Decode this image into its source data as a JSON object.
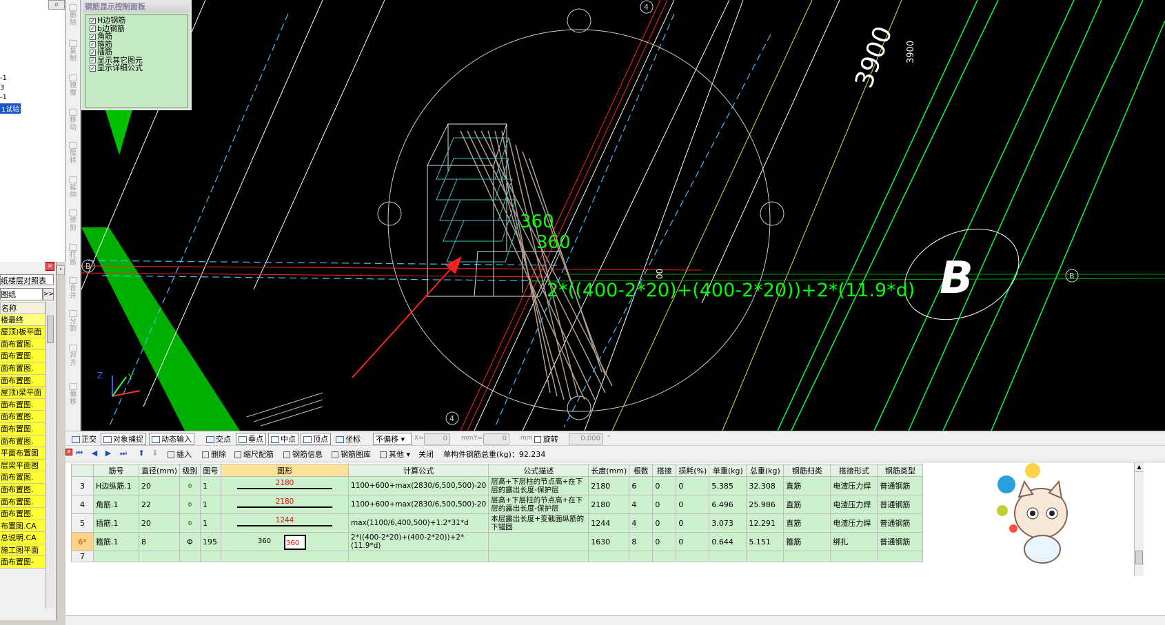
{
  "left_tree": {
    "search_icon": "search-icon",
    "items": [
      "-1",
      "3",
      "-1",
      "1试验"
    ]
  },
  "drawing_list": {
    "tab_label": "纸楼层对照表",
    "combo_value": "图纸",
    "combo_btn": ">>",
    "header": "名称",
    "rows": [
      "楼最终",
      "屋顶)板平面",
      "面布置图.",
      "面布置图.",
      "面布置图.",
      "面布置图.",
      "屋顶)梁平面",
      "面布置图.",
      "面布置图.",
      "面布置图.",
      "面布置图.",
      "平面布置图",
      "层梁平面图",
      "面布置图.",
      "面布置图.",
      "面布置图.",
      "面布置图.",
      "布置图.CA",
      "总说明.CA",
      "施工图平面",
      "面布置图-"
    ]
  },
  "vertical_toolbar": [
    "删除",
    "复制",
    "镜像",
    "移动",
    "旋转",
    "延伸",
    "修剪",
    "打断",
    "合并",
    "分割",
    "对齐",
    "偏移"
  ],
  "rebar_panel": {
    "title": "钢筋显示控制面板",
    "items": [
      "H边钢筋",
      "b边钢筋",
      "角筋",
      "箍筋",
      "插筋",
      "显示其它图元",
      "显示详细公式"
    ]
  },
  "canvas": {
    "dim_3900_big": "3900",
    "dim_3900_small": "3900",
    "axis_4": "4",
    "axis_B": "B",
    "big_B": "B",
    "label_360a": "360",
    "label_360b": "360",
    "formula": "2*((400-2*20)+(400-2*20))+2*(11.9*d)",
    "dim_00": "00",
    "axes_z": "Z",
    "axes_y": "Y",
    "colors": {
      "green_member": "#00c000",
      "text_green": "#00ff00",
      "arrow": "#ff2020"
    }
  },
  "snap_toolbar": {
    "ortho": "正交",
    "obj_snap": "对象捕捉",
    "dyn_input": "动态输入",
    "intersect": "交点",
    "perp": "垂点",
    "mid": "中点",
    "vertex": "顶点",
    "coord": "坐标",
    "offset_mode": "不偏移",
    "x_label": "X=",
    "x_val": "0",
    "y_label": "Y=",
    "y_val": "0",
    "unit": "mm",
    "rotate": "旋转",
    "rot_val": "0.000",
    "deg": "°"
  },
  "table_toolbar": {
    "insert": "插入",
    "delete": "删除",
    "scale_rebar": "缩尺配筋",
    "rebar_info": "钢筋信息",
    "rebar_lib": "钢筋图库",
    "other": "其他",
    "close": "关闭",
    "total_weight": "单构件钢筋总重(kg)：92.234"
  },
  "table": {
    "headers": [
      "筋号",
      "直径(mm)",
      "级别",
      "图号",
      "图形",
      "计算公式",
      "公式描述",
      "长度(mm)",
      "根数",
      "搭接",
      "损耗(%)",
      "单重(kg)",
      "总重(kg)",
      "钢筋归类",
      "搭接形式",
      "钢筋类型"
    ],
    "rows": [
      {
        "no": "3",
        "name": "H边纵筋.1",
        "dia": "20",
        "grade": "⌽",
        "fig": "1",
        "shape": "2180",
        "formula": "1100+600+max(2830/6,500,500)-20",
        "desc": "层高+下层柱的节点高+在下层的露出长度-保护层",
        "len": "2180",
        "count": "6",
        "lap": "0",
        "loss": "0",
        "unit_w": "5.385",
        "total_w": "32.308",
        "cat": "直筋",
        "lap_type": "电渣压力焊",
        "type": "普通钢筋"
      },
      {
        "no": "4",
        "name": "角筋.1",
        "dia": "22",
        "grade": "⌽",
        "fig": "1",
        "shape": "2180",
        "formula": "1100+600+max(2830/6,500,500)-20",
        "desc": "层高+下层柱的节点高+在下层的露出长度-保护层",
        "len": "2180",
        "count": "4",
        "lap": "0",
        "loss": "0",
        "unit_w": "6.496",
        "total_w": "25.986",
        "cat": "直筋",
        "lap_type": "电渣压力焊",
        "type": "普通钢筋"
      },
      {
        "no": "5",
        "name": "插筋.1",
        "dia": "20",
        "grade": "⌽",
        "fig": "1",
        "shape": "1244",
        "formula": "max(1100/6,400,500)+1.2*31*d",
        "desc": "本层露出长度+变截面纵筋的下锚固",
        "len": "1244",
        "count": "4",
        "lap": "0",
        "loss": "0",
        "unit_w": "3.073",
        "total_w": "12.291",
        "cat": "直筋",
        "lap_type": "电渣压力焊",
        "type": "普通钢筋"
      },
      {
        "no": "6*",
        "name": "箍筋.1",
        "dia": "8",
        "grade": "Φ",
        "fig": "195",
        "shape_left": "360",
        "shape_box": "360",
        "formula": "2*((400-2*20)+(400-2*20))+2*(11.9*d)",
        "desc": "",
        "len": "1630",
        "count": "8",
        "lap": "0",
        "loss": "0",
        "unit_w": "0.644",
        "total_w": "5.151",
        "cat": "箍筋",
        "lap_type": "绑扎",
        "type": "普通钢筋"
      },
      {
        "no": "7"
      }
    ]
  }
}
